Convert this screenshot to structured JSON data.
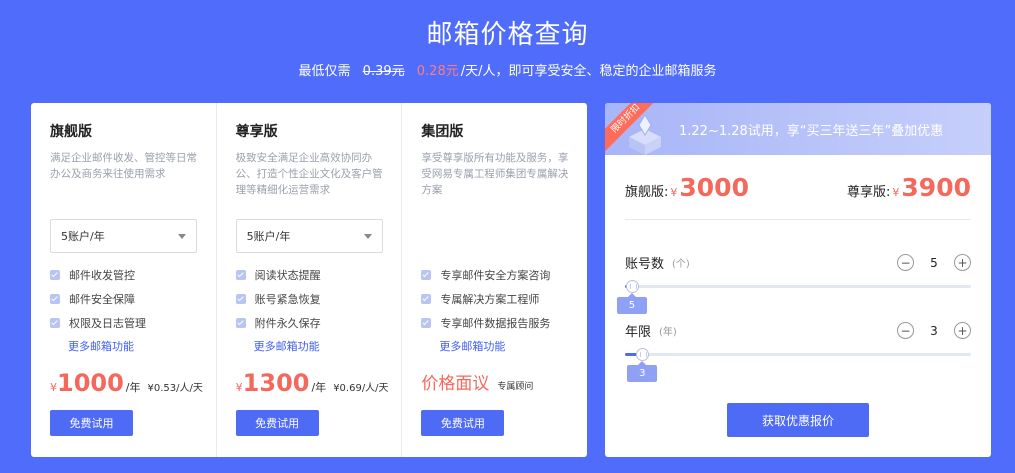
{
  "hero": {
    "title": "邮箱价格查询",
    "sub_prefix": "最低仅需",
    "old_price": "0.39元",
    "new_price": "0.28元",
    "sub_suffix": "/天/人，即可享受安全、稳定的企业邮箱服务"
  },
  "plans": [
    {
      "name": "旗舰版",
      "desc": "满足企业邮件收发、管控等日常办公及商务来往使用需求",
      "select_value": "5账户/年",
      "features": [
        "邮件收发管控",
        "邮件安全保障",
        "权限及日志管理"
      ],
      "more": "更多邮箱功能",
      "currency": "¥",
      "price": "1000",
      "unit": "/年",
      "daily": "¥0.53/人/天",
      "trial": "免费试用"
    },
    {
      "name": "尊享版",
      "desc": "极致安全满足企业高效协同办公、打造个性企业文化及客户管理等精细化运营需求",
      "select_value": "5账户/年",
      "features": [
        "阅读状态提醒",
        "账号紧急恢复",
        "附件永久保存"
      ],
      "more": "更多邮箱功能",
      "currency": "¥",
      "price": "1300",
      "unit": "/年",
      "daily": "¥0.69/人/天",
      "trial": "免费试用"
    },
    {
      "name": "集团版",
      "desc": "享受尊享版所有功能及服务，享受网易专属工程师集团专属解决方案",
      "features": [
        "专享邮件安全方案咨询",
        "专属解决方案工程师",
        "专享邮件数据报告服务"
      ],
      "more": "更多邮箱功能",
      "negotiable": "价格面议",
      "tag": "专属顾问",
      "trial": "免费试用"
    }
  ],
  "quote": {
    "ribbon": "限时折扣",
    "promo": "1.22~1.28试用，享“买三年送三年”叠加优惠",
    "flagship_label": "旗舰版:",
    "flagship_currency": "¥",
    "flagship_price": "3000",
    "premium_label": "尊享版:",
    "premium_currency": "¥",
    "premium_price": "3900",
    "accounts": {
      "label": "账号数",
      "hint": "(个)",
      "value": "5",
      "fraction": 0.02
    },
    "years": {
      "label": "年限",
      "hint": "(年)",
      "value": "3",
      "fraction": 0.05
    },
    "minus": "−",
    "plus": "+",
    "cta": "获取优惠报价"
  },
  "colors": {
    "background": "#4f6dfa",
    "accent": "#4d6bf5",
    "price": "#f5685c"
  },
  "icons": {
    "feature": "checkbox-icon",
    "dropdown": "caret-down-icon",
    "promo": "gift-box-icon"
  }
}
